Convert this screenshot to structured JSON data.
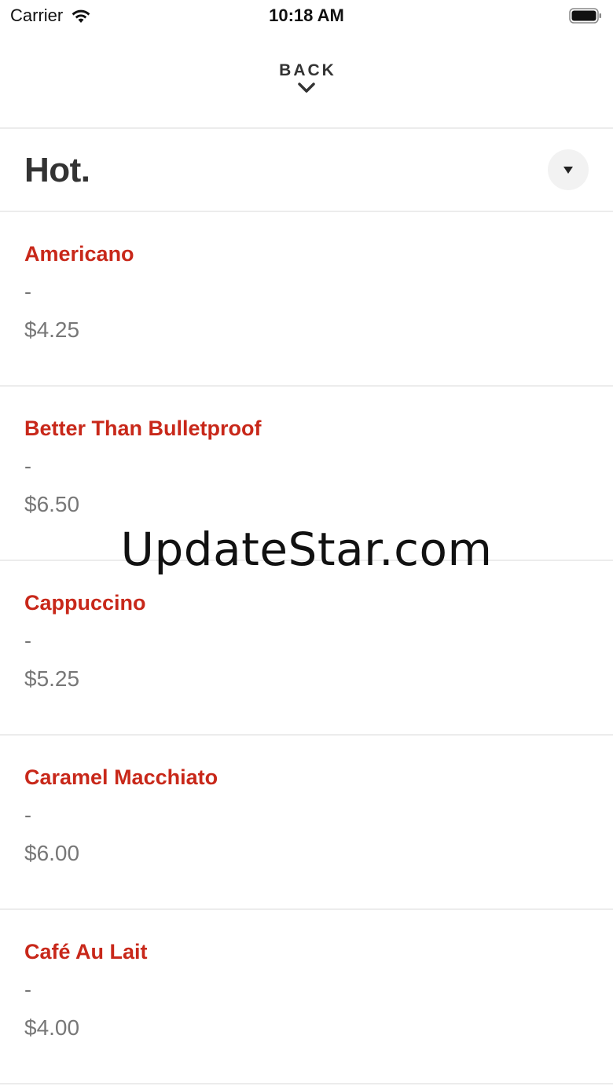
{
  "status_bar": {
    "carrier": "Carrier",
    "time": "10:18 AM",
    "wifi_icon": "wifi-icon",
    "battery_icon": "battery-full-icon"
  },
  "header": {
    "back_label": "BACK",
    "back_icon": "chevron-down-icon"
  },
  "section": {
    "title": "Hot.",
    "dropdown_icon": "caret-down-icon"
  },
  "menu": {
    "items": [
      {
        "name": "Americano",
        "description": "-",
        "price": "$4.25"
      },
      {
        "name": "Better Than Bulletproof",
        "description": "-",
        "price": "$6.50"
      },
      {
        "name": "Cappuccino",
        "description": "-",
        "price": "$5.25"
      },
      {
        "name": "Caramel Macchiato",
        "description": "-",
        "price": "$6.00"
      },
      {
        "name": "Café Au Lait",
        "description": "-",
        "price": "$4.00"
      }
    ]
  },
  "watermark": "UpdateStar.com",
  "colors": {
    "item_name": "#c8281a",
    "secondary_text": "#777777",
    "title_text": "#333333",
    "divider": "#ececec"
  }
}
